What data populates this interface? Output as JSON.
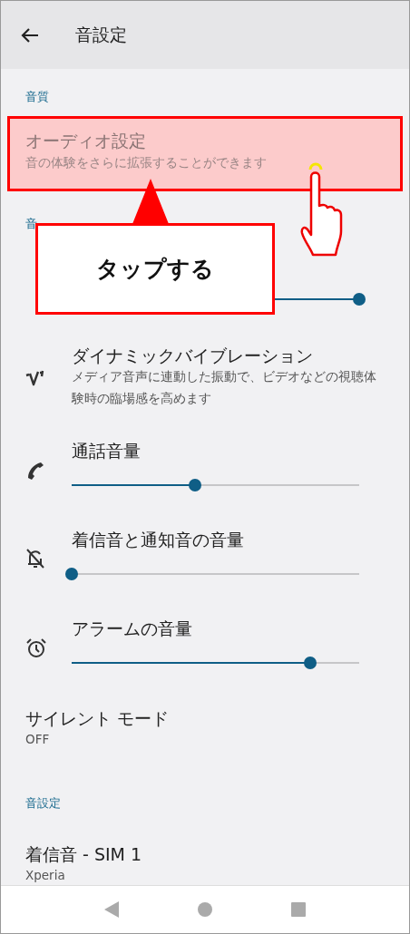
{
  "app_bar": {
    "title": "音設定"
  },
  "items": [
    {
      "kind": "header",
      "label": "音質"
    },
    {
      "kind": "text",
      "title": "オーディオ設定",
      "summary": "音の体験をさらに拡張することができます",
      "highlighted": true
    },
    {
      "kind": "header",
      "label": "音"
    },
    {
      "kind": "slider",
      "level": 1.0
    },
    {
      "kind": "text",
      "title": "ダイナミックバイブレーション",
      "summary": "メディア音声に連動した振動で、ビデオなどの視聴体験時の臨場感を高めます",
      "highlighted": false
    },
    {
      "kind": "slider",
      "title": "通話音量",
      "level": 0.43
    },
    {
      "kind": "slider",
      "title": "着信音と通知音の音量",
      "level": 0.0
    },
    {
      "kind": "slider",
      "title": "アラームの音量",
      "level": 0.83
    },
    {
      "kind": "text",
      "title": "サイレント モード",
      "summary": "OFF",
      "highlighted": false
    },
    {
      "kind": "header",
      "label": "音設定"
    },
    {
      "kind": "text",
      "title": "着信音 - SIM 1",
      "summary": "Xperia",
      "highlighted": false
    }
  ],
  "callout": {
    "label": "タップする"
  }
}
